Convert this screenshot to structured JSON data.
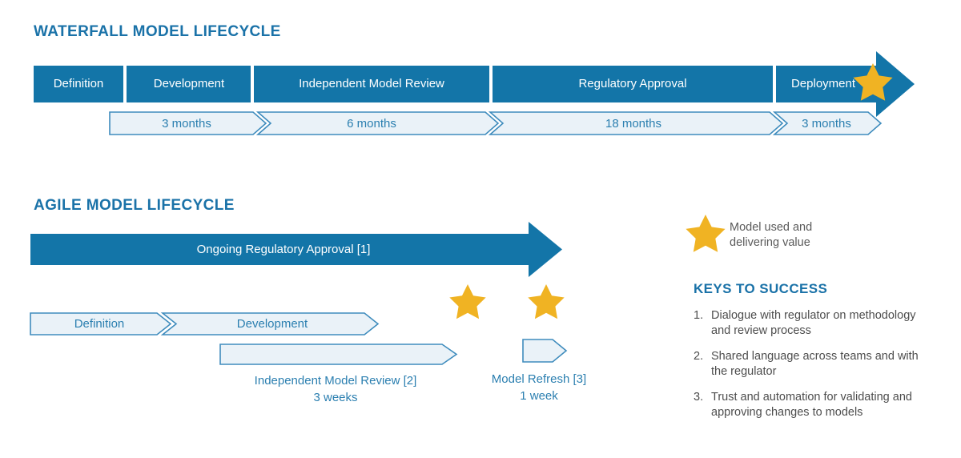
{
  "colors": {
    "brand_blue": "#1a72a8",
    "dark_blue_fill": "#1375a8",
    "light_fill": "#eaf2f8",
    "light_stroke": "#3f8cbd",
    "star_gold": "#f0b323",
    "text_gray": "#4d4d4d",
    "white": "#ffffff"
  },
  "waterfall": {
    "title": "WATERFALL MODEL LIFECYCLE",
    "phases": [
      {
        "label": "Definition",
        "duration": ""
      },
      {
        "label": "Development",
        "duration": "3 months"
      },
      {
        "label": "Independent Model Review",
        "duration": "6 months"
      },
      {
        "label": "Regulatory Approval",
        "duration": "18 months"
      },
      {
        "label": "Deployment",
        "duration": "3 months"
      }
    ],
    "star_icon": "star-icon"
  },
  "agile": {
    "title": "AGILE MODEL LIFECYCLE",
    "ongoing_bar": {
      "label": "Ongoing Regulatory Approval [1]"
    },
    "phases": [
      {
        "label": "Definition"
      },
      {
        "label": "Development"
      }
    ],
    "review": {
      "label": "Independent Model Review [2]",
      "duration": "3 weeks"
    },
    "refresh": {
      "label": "Model Refresh [3]",
      "duration": "1 week"
    },
    "stars": [
      "star-icon",
      "star-icon"
    ]
  },
  "legend": {
    "icon": "star-icon",
    "line1": "Model used and",
    "line2": "delivering value"
  },
  "keys": {
    "title": "KEYS TO SUCCESS",
    "items": [
      {
        "num": "1.",
        "text": "Dialogue with regulator on methodology and review process"
      },
      {
        "num": "2.",
        "text": "Shared language across teams and with the regulator"
      },
      {
        "num": "3.",
        "text": "Trust and automation for validating and approving changes to models"
      }
    ]
  }
}
